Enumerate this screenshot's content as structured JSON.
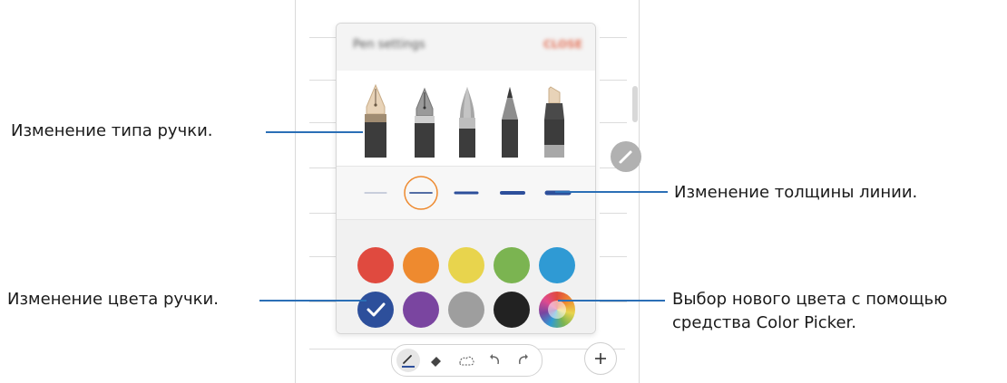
{
  "panel": {
    "title": "Pen settings",
    "close_label": "CLOSE",
    "pen_types": [
      "fountain-pen-icon",
      "calligraphy-pen-icon",
      "pen-icon",
      "pencil-icon",
      "marker-icon"
    ],
    "selected_pen": "fountain-pen-icon",
    "thickness_options": 5,
    "selected_thickness": 2,
    "colors_row1": [
      "#e04a3f",
      "#ee8a2f",
      "#e8d44d",
      "#7bb451",
      "#2f9ad4"
    ],
    "colors_row2": [
      "#2d4f9b",
      "#7a45a0",
      "#9e9e9e",
      "#222222",
      "color-picker"
    ],
    "selected_color": "#2d4f9b"
  },
  "callouts": {
    "pen_type": "Изменение типа ручки.",
    "line_thickness": "Изменение толщины линии.",
    "pen_color": "Изменение цвета ручки.",
    "color_picker_line1": "Выбор нового цвета с помощью",
    "color_picker_line2": "средства Color Picker."
  },
  "toolbar": {
    "tools": [
      "pen-icon",
      "eraser-icon",
      "selection-icon",
      "undo-icon",
      "redo-icon"
    ],
    "add_icon": "plus-icon"
  },
  "colors": {
    "accent": "#2b6fb6",
    "selection_ring": "#ee8a2f"
  }
}
